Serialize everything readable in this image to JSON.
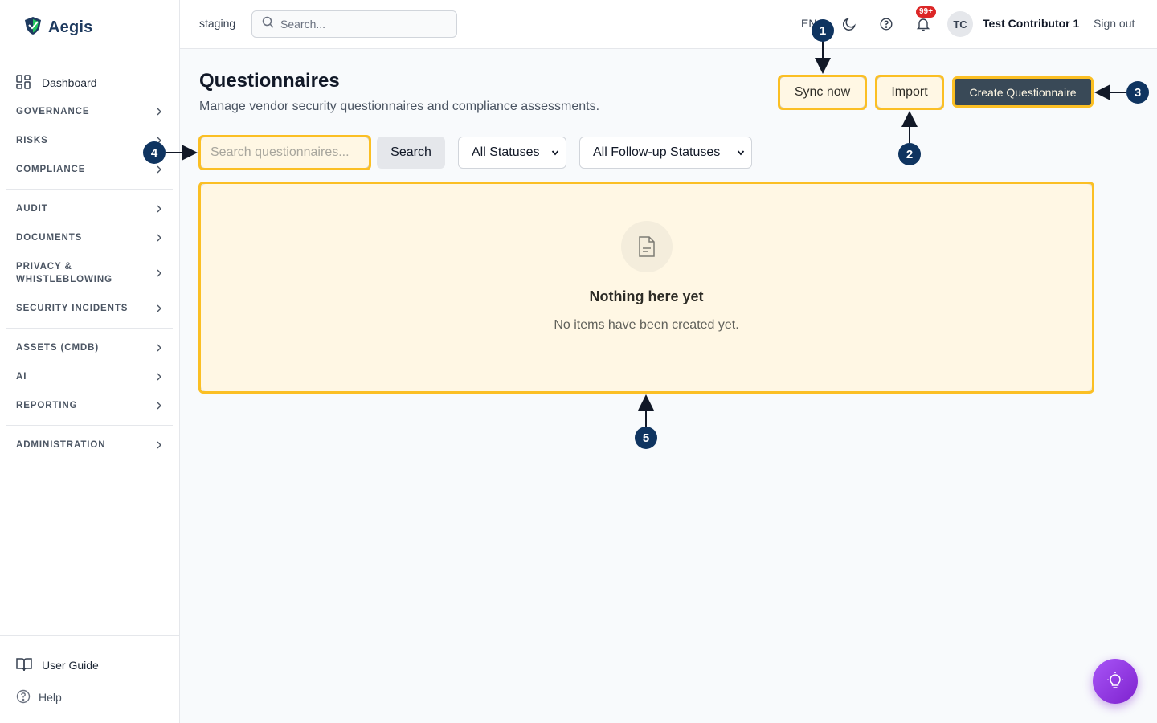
{
  "app": {
    "name": "Aegis",
    "environment": "staging"
  },
  "topbar": {
    "search_placeholder": "Search...",
    "language": "EN",
    "notifications_badge": "99+",
    "user_initials": "TC",
    "user_name": "Test Contributor 1",
    "sign_out": "Sign out"
  },
  "sidebar": {
    "dashboard": "Dashboard",
    "sections": [
      "GOVERNANCE",
      "RISKS",
      "COMPLIANCE",
      "AUDIT",
      "DOCUMENTS",
      "PRIVACY & WHISTLEBLOWING",
      "SECURITY INCIDENTS",
      "ASSETS (CMDB)",
      "AI",
      "REPORTING",
      "ADMINISTRATION"
    ],
    "footer": {
      "user_guide": "User Guide",
      "help": "Help"
    }
  },
  "page": {
    "title": "Questionnaires",
    "subtitle": "Manage vendor security questionnaires and compliance assessments.",
    "actions": {
      "sync": "Sync now",
      "import": "Import",
      "create": "Create Questionnaire"
    }
  },
  "filters": {
    "search_placeholder": "Search questionnaires...",
    "search_button": "Search",
    "status_select": "All Statuses",
    "followup_select": "All Follow-up Statuses"
  },
  "empty_state": {
    "title": "Nothing here yet",
    "message": "No items have been created yet."
  },
  "callouts": [
    "1",
    "2",
    "3",
    "4",
    "5"
  ],
  "colors": {
    "brand": "#1e3a5f",
    "highlight": "#fbbf24",
    "callout": "#0f3460",
    "badge": "#dc2626"
  }
}
